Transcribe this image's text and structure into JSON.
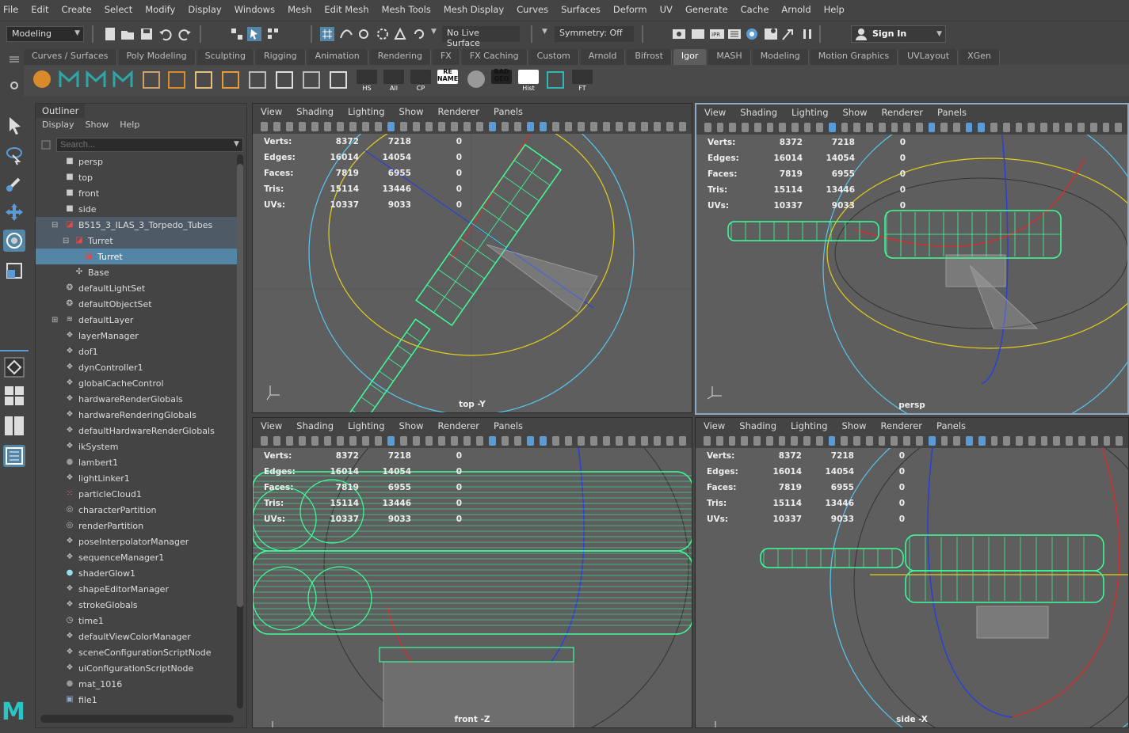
{
  "menubar": [
    "File",
    "Edit",
    "Create",
    "Select",
    "Modify",
    "Display",
    "Windows",
    "Mesh",
    "Edit Mesh",
    "Mesh Tools",
    "Mesh Display",
    "Curves",
    "Surfaces",
    "Deform",
    "UV",
    "Generate",
    "Cache",
    "Arnold",
    "Help"
  ],
  "status": {
    "workspace": "Modeling",
    "live_surface": "No Live Surface",
    "symmetry": "Symmetry: Off",
    "sign_in": "Sign In"
  },
  "shelf": {
    "tabs": [
      "Curves / Surfaces",
      "Poly Modeling",
      "Sculpting",
      "Rigging",
      "Animation",
      "Rendering",
      "FX",
      "FX Caching",
      "Custom",
      "Arnold",
      "Bifrost",
      "Igor",
      "MASH",
      "Modeling",
      "Motion Graphics",
      "UVLayout",
      "XGen"
    ],
    "active_tab": "Igor",
    "buttons": [
      {
        "icon": "sphere-orange-icon",
        "label": ""
      },
      {
        "icon": "maya-m-icon",
        "label": ""
      },
      {
        "icon": "maya-m-icon",
        "label": ""
      },
      {
        "icon": "maya-m-icon",
        "label": ""
      },
      {
        "icon": "cube-icon",
        "label": ""
      },
      {
        "icon": "pivot-icon",
        "label": ""
      },
      {
        "icon": "layers-icon",
        "label": ""
      },
      {
        "icon": "squares-icon",
        "label": ""
      },
      {
        "icon": "grid-icon",
        "label": ""
      },
      {
        "icon": "pencil-icon",
        "label": ""
      },
      {
        "icon": "bars-icon",
        "label": ""
      },
      {
        "icon": "pen-icon",
        "label": ""
      },
      {
        "icon": "eye-icon",
        "label": "HS"
      },
      {
        "icon": "eye-icon",
        "label": "All"
      },
      {
        "icon": "axis-icon",
        "label": "CP"
      },
      {
        "icon": "rename-icon",
        "label": "RE NAME"
      },
      {
        "icon": "sphere-gray-icon",
        "label": ""
      },
      {
        "icon": "badgeo-icon",
        "label": "BAD GEO"
      },
      {
        "icon": "hist-icon",
        "label": "Hist"
      },
      {
        "icon": "loop-icon",
        "label": ""
      },
      {
        "icon": "axis-icon",
        "label": "FT"
      }
    ]
  },
  "outliner": {
    "title": "Outliner",
    "menu": [
      "Display",
      "Show",
      "Help"
    ],
    "search_placeholder": "Search...",
    "items": [
      {
        "label": "persp",
        "icon": "camera-icon",
        "indent": 0,
        "state": ""
      },
      {
        "label": "top",
        "icon": "camera-icon",
        "indent": 0,
        "state": ""
      },
      {
        "label": "front",
        "icon": "camera-icon",
        "indent": 0,
        "state": ""
      },
      {
        "label": "side",
        "icon": "camera-icon",
        "indent": 0,
        "state": ""
      },
      {
        "label": "B515_3_ILAS_3_Torpedo_Tubes",
        "icon": "transform-icon",
        "indent": 0,
        "state": "grp"
      },
      {
        "label": "Turret",
        "icon": "transform-icon",
        "indent": 1,
        "state": "grp"
      },
      {
        "label": "Turret",
        "icon": "transform-icon",
        "indent": 2,
        "state": "sel"
      },
      {
        "label": "Base",
        "icon": "locator-icon",
        "indent": 1,
        "state": ""
      },
      {
        "label": "defaultLightSet",
        "icon": "set-icon",
        "indent": 0,
        "state": ""
      },
      {
        "label": "defaultObjectSet",
        "icon": "set-icon",
        "indent": 0,
        "state": ""
      },
      {
        "label": "defaultLayer",
        "icon": "layer-icon",
        "indent": 0,
        "state": ""
      },
      {
        "label": "layerManager",
        "icon": "node-icon",
        "indent": 0,
        "state": ""
      },
      {
        "label": "dof1",
        "icon": "node-icon",
        "indent": 0,
        "state": ""
      },
      {
        "label": "dynController1",
        "icon": "node-icon",
        "indent": 0,
        "state": ""
      },
      {
        "label": "globalCacheControl",
        "icon": "node-icon",
        "indent": 0,
        "state": ""
      },
      {
        "label": "hardwareRenderGlobals",
        "icon": "node-icon",
        "indent": 0,
        "state": ""
      },
      {
        "label": "hardwareRenderingGlobals",
        "icon": "node-icon",
        "indent": 0,
        "state": ""
      },
      {
        "label": "defaultHardwareRenderGlobals",
        "icon": "node-icon",
        "indent": 0,
        "state": ""
      },
      {
        "label": "ikSystem",
        "icon": "node-icon",
        "indent": 0,
        "state": ""
      },
      {
        "label": "lambert1",
        "icon": "shader-icon",
        "indent": 0,
        "state": ""
      },
      {
        "label": "lightLinker1",
        "icon": "node-icon",
        "indent": 0,
        "state": ""
      },
      {
        "label": "particleCloud1",
        "icon": "particle-icon",
        "indent": 0,
        "state": ""
      },
      {
        "label": "characterPartition",
        "icon": "partition-icon",
        "indent": 0,
        "state": ""
      },
      {
        "label": "renderPartition",
        "icon": "partition-icon",
        "indent": 0,
        "state": ""
      },
      {
        "label": "poseInterpolatorManager",
        "icon": "node-icon",
        "indent": 0,
        "state": ""
      },
      {
        "label": "sequenceManager1",
        "icon": "node-icon",
        "indent": 0,
        "state": ""
      },
      {
        "label": "shaderGlow1",
        "icon": "glow-icon",
        "indent": 0,
        "state": ""
      },
      {
        "label": "shapeEditorManager",
        "icon": "node-icon",
        "indent": 0,
        "state": ""
      },
      {
        "label": "strokeGlobals",
        "icon": "node-icon",
        "indent": 0,
        "state": ""
      },
      {
        "label": "time1",
        "icon": "clock-icon",
        "indent": 0,
        "state": ""
      },
      {
        "label": "defaultViewColorManager",
        "icon": "node-icon",
        "indent": 0,
        "state": ""
      },
      {
        "label": "sceneConfigurationScriptNode",
        "icon": "node-icon",
        "indent": 0,
        "state": ""
      },
      {
        "label": "uiConfigurationScriptNode",
        "icon": "node-icon",
        "indent": 0,
        "state": ""
      },
      {
        "label": "mat_1016",
        "icon": "shader-icon",
        "indent": 0,
        "state": ""
      },
      {
        "label": "file1",
        "icon": "file-icon",
        "indent": 0,
        "state": ""
      }
    ]
  },
  "viewport_menu": [
    "View",
    "Shading",
    "Lighting",
    "Show",
    "Renderer",
    "Panels"
  ],
  "hud": {
    "rows": [
      {
        "key": "Verts:",
        "v1": "8372",
        "v2": "7218",
        "v3": "0"
      },
      {
        "key": "Edges:",
        "v1": "16014",
        "v2": "14054",
        "v3": "0"
      },
      {
        "key": "Faces:",
        "v1": "7819",
        "v2": "6955",
        "v3": "0"
      },
      {
        "key": "Tris:",
        "v1": "15114",
        "v2": "13446",
        "v3": "0"
      },
      {
        "key": "UVs:",
        "v1": "10337",
        "v2": "9033",
        "v3": "0"
      }
    ]
  },
  "viewports": [
    {
      "camera": "top -Y"
    },
    {
      "camera": "persp"
    },
    {
      "camera": "front -Z"
    },
    {
      "camera": "side -X"
    }
  ],
  "colors": {
    "wire": "#3dff9a",
    "selection": "#5285a6",
    "manip_yellow": "#e5d01a",
    "manip_blue": "#2a3fd8",
    "manip_red": "#d03030",
    "manip_cyan": "#56c8f0"
  }
}
